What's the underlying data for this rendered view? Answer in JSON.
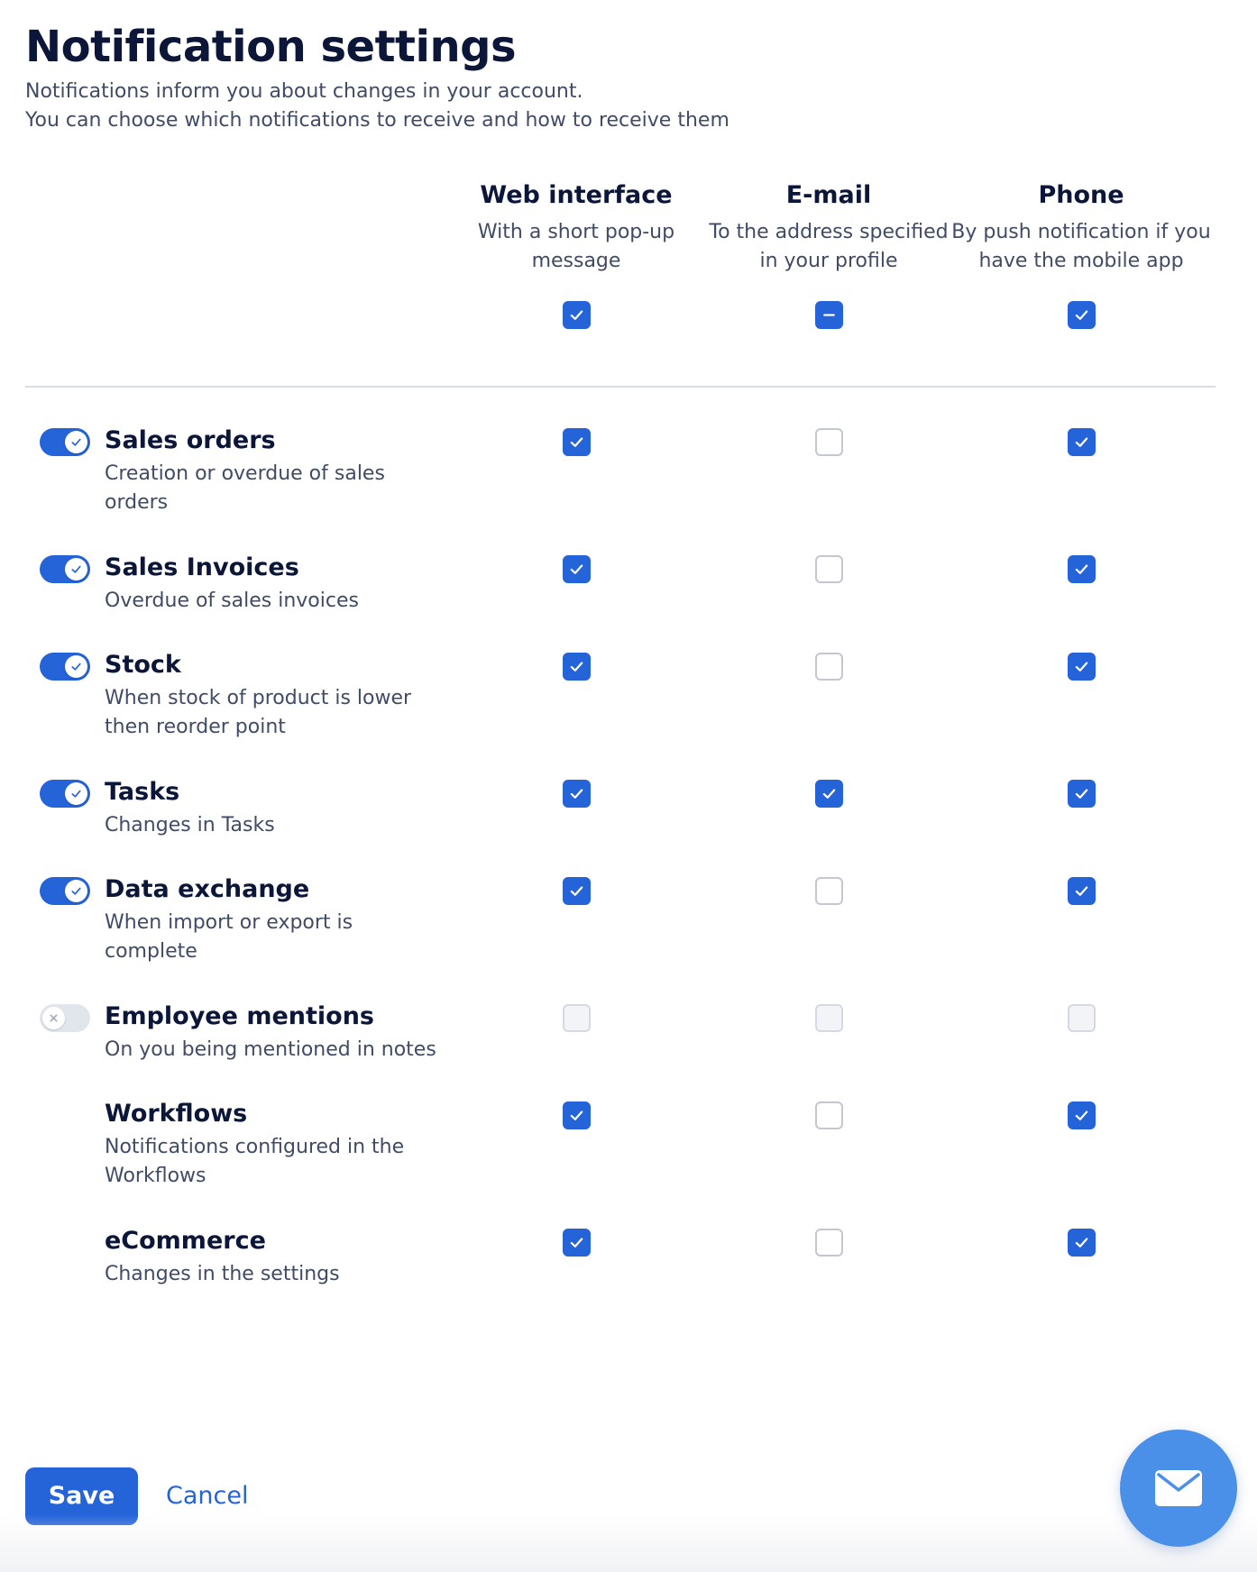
{
  "page": {
    "title": "Notification settings",
    "subtitle_line1": "Notifications inform you about changes in your account.",
    "subtitle_line2": "You can choose which notifications to receive and how to receive them"
  },
  "columns": [
    {
      "title": "Web interface",
      "description": "With a short pop-up message",
      "master_state": "checked"
    },
    {
      "title": "E-mail",
      "description": "To the address specified in your profile",
      "master_state": "mixed"
    },
    {
      "title": "Phone",
      "description": "By push notification if you have the mobile app",
      "master_state": "checked"
    }
  ],
  "rows": [
    {
      "name": "Sales orders",
      "description": "Creation or overdue of sales orders",
      "toggle": "on",
      "web": "checked",
      "email": "unchecked",
      "phone": "checked"
    },
    {
      "name": "Sales Invoices",
      "description": "Overdue of sales invoices",
      "toggle": "on",
      "web": "checked",
      "email": "unchecked",
      "phone": "checked"
    },
    {
      "name": "Stock",
      "description": "When stock of product is lower then reorder point",
      "toggle": "on",
      "web": "checked",
      "email": "unchecked",
      "phone": "checked"
    },
    {
      "name": "Tasks",
      "description": "Changes in Tasks",
      "toggle": "on",
      "web": "checked",
      "email": "checked",
      "phone": "checked"
    },
    {
      "name": "Data exchange",
      "description": "When import or export is complete",
      "toggle": "on",
      "web": "checked",
      "email": "unchecked",
      "phone": "checked"
    },
    {
      "name": "Employee mentions",
      "description": "On you being mentioned in notes",
      "toggle": "off",
      "web": "disabled",
      "email": "disabled",
      "phone": "disabled"
    },
    {
      "name": "Workflows",
      "description": "Notifications configured in the Workflows",
      "toggle": "none",
      "web": "checked",
      "email": "unchecked",
      "phone": "checked"
    },
    {
      "name": "eCommerce",
      "description": "Changes in the settings",
      "toggle": "none",
      "web": "checked",
      "email": "unchecked",
      "phone": "checked"
    }
  ],
  "actions": {
    "save_label": "Save",
    "cancel_label": "Cancel"
  },
  "icons": {
    "chat_button": "envelope-icon"
  },
  "colors": {
    "accent": "#2563d9",
    "fab": "#4a8fe8",
    "text_primary": "#0b1638",
    "text_secondary": "#414b66"
  }
}
